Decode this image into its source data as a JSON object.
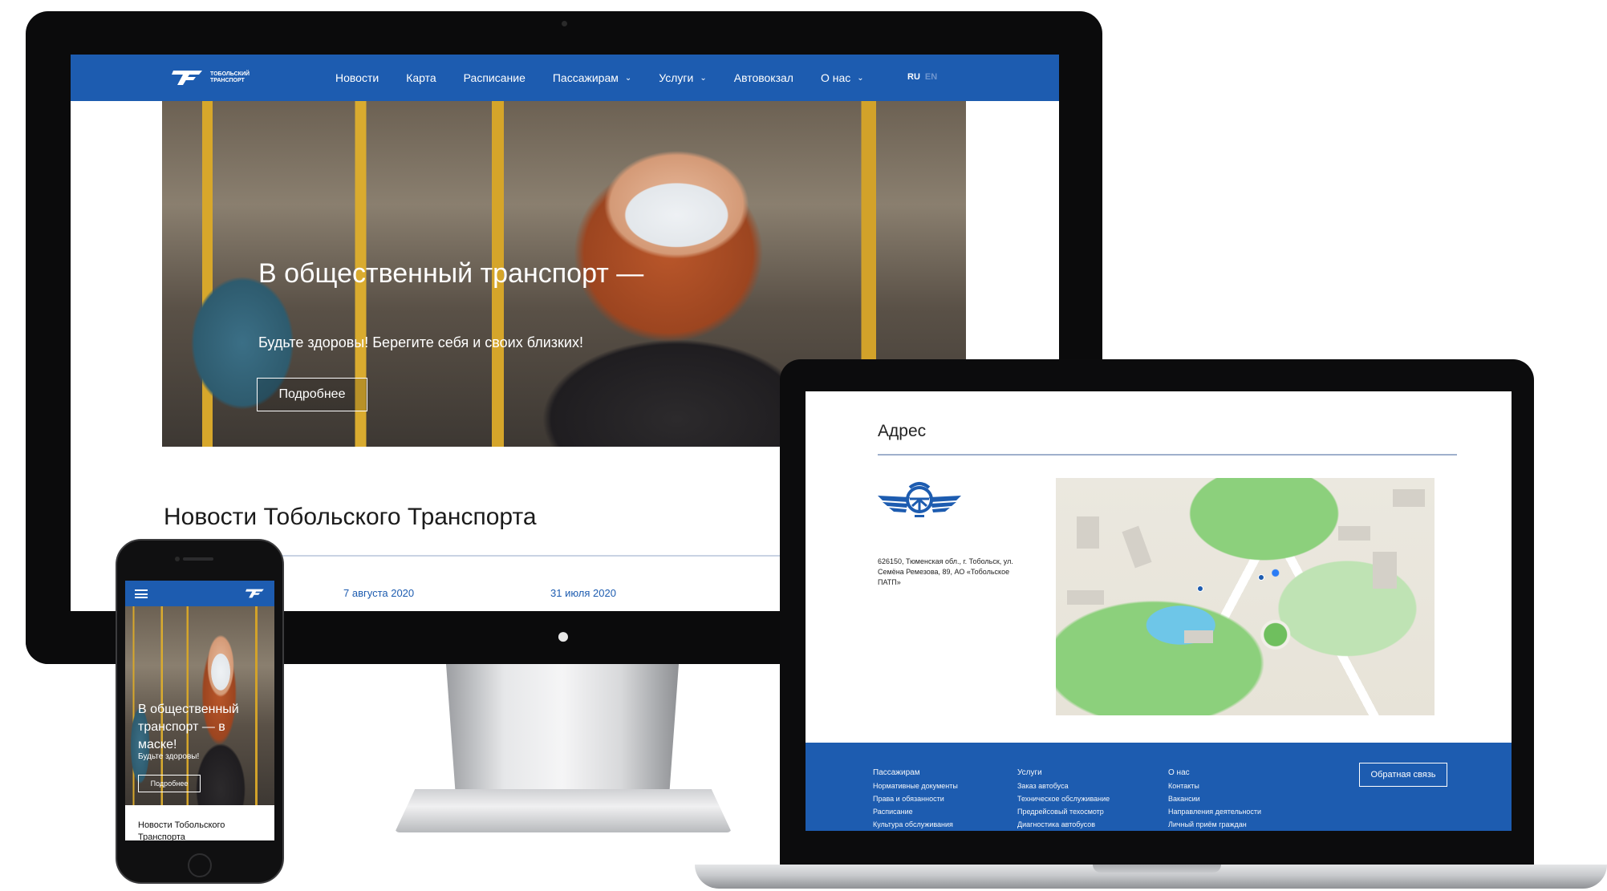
{
  "site": {
    "logo_text": "ТОБОЛЬСКИЙ ТРАНСПОРТ",
    "nav": [
      {
        "label": "Новости",
        "has_caret": false
      },
      {
        "label": "Карта",
        "has_caret": false
      },
      {
        "label": "Расписание",
        "has_caret": false
      },
      {
        "label": "Пассажирам",
        "has_caret": true
      },
      {
        "label": "Услуги",
        "has_caret": true
      },
      {
        "label": "Автовокзал",
        "has_caret": false
      },
      {
        "label": "О нас",
        "has_caret": true
      }
    ],
    "lang": {
      "active": "RU",
      "inactive": "EN"
    },
    "colors": {
      "brand_blue": "#1d5cb0"
    }
  },
  "hero": {
    "title": "В общественный транспорт —",
    "subtitle": "Будьте здоровы! Берегите себя и своих близких!",
    "button": "Подробнее"
  },
  "news": {
    "title": "Новости Тобольского Транспорта",
    "dates": [
      "7 августа 2020",
      "31 июля 2020"
    ]
  },
  "address_section": {
    "title": "Адрес",
    "text": "626150, Тюменская обл., г. Тобольск, ул. Семёна Ремезова, 89, АО «Тобольское ПАТП»",
    "map_icon": "map-icon"
  },
  "footer": {
    "columns": [
      {
        "links": [
          "Пассажирам",
          "Нормативные документы",
          "Права и обязанности",
          "Расписание",
          "Культура обслуживания"
        ]
      },
      {
        "links": [
          "Услуги",
          "Заказ автобуса",
          "Техническое обслуживание",
          "Предрейсовый техосмотр",
          "Диагностика автобусов"
        ]
      },
      {
        "links": [
          "О нас",
          "Контакты",
          "Вакансии",
          "Направления деятельности",
          "Личный приём граждан"
        ]
      }
    ],
    "feedback_button": "Обратная связь"
  },
  "mobile": {
    "menu_icon": "hamburger-icon",
    "hero_title": "В общественный транспорт — в маске!",
    "hero_subtitle": "Будьте здоровы!",
    "hero_button": "Подробнее",
    "news_title": "Новости Тобольского Транспорта"
  }
}
